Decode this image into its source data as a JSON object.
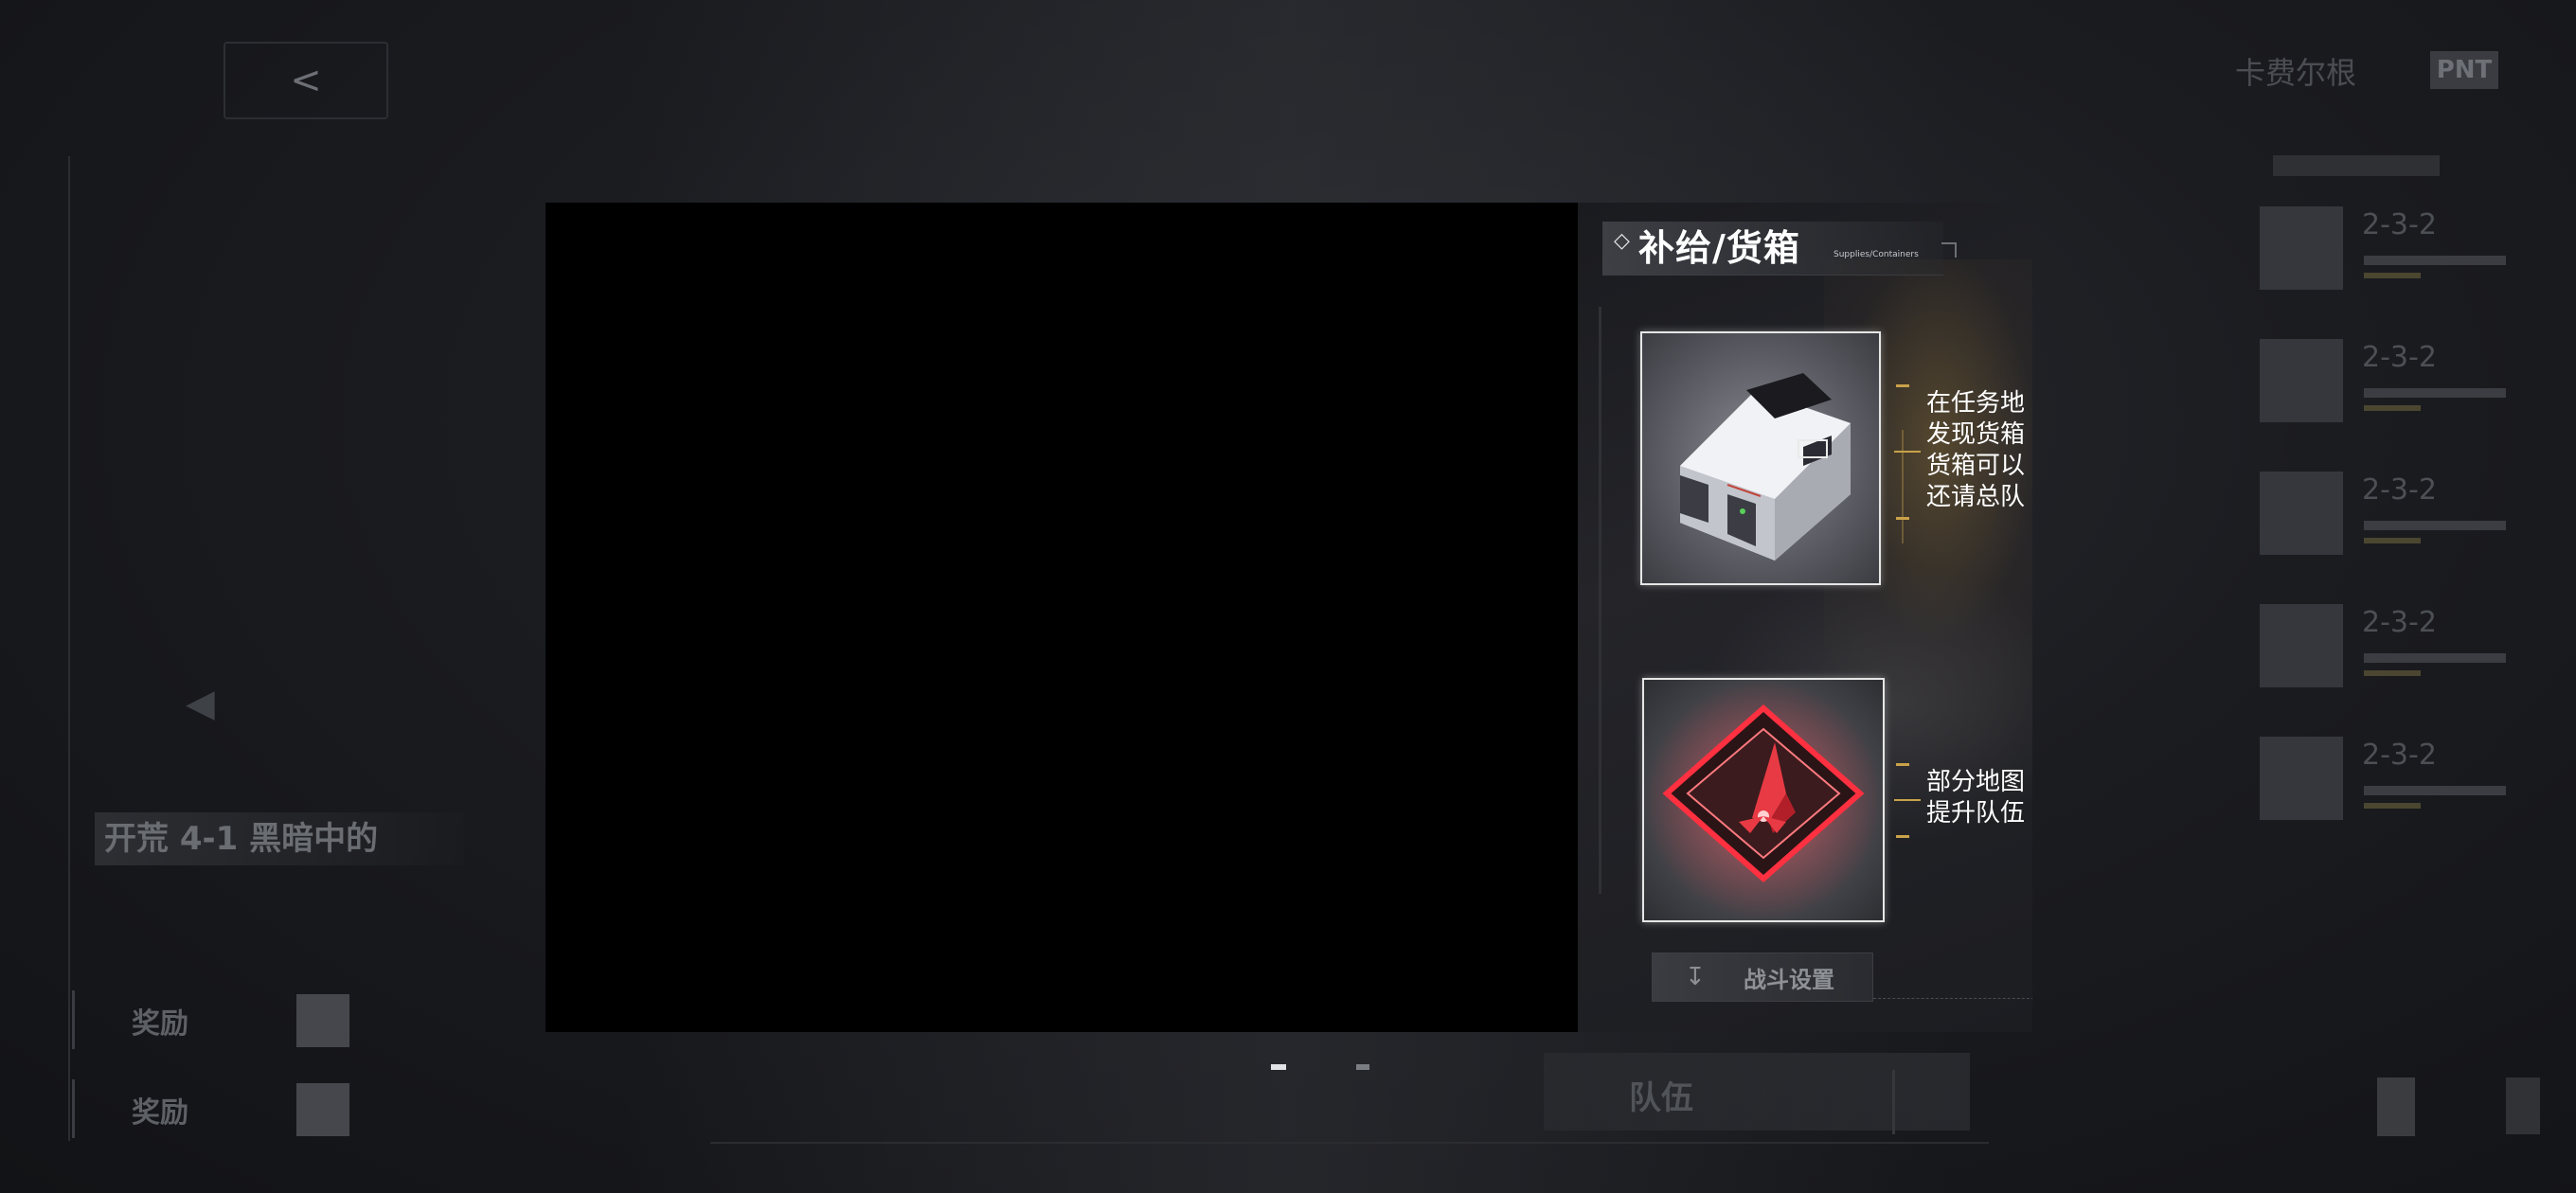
{
  "background": {
    "back_button_icon": "back-arrow-icon",
    "back_button_symbol": "<",
    "top_right_label": "卡费尔根",
    "top_right_tag": "PNT",
    "left_stage_title": "开荒 4-1 黑暗中的",
    "left_slots": [
      {
        "text": "奖励"
      },
      {
        "text": "奖励"
      }
    ],
    "squad_button_label": "队伍",
    "roster": [
      {
        "name": "2-3-2"
      },
      {
        "name": "2-3-2"
      },
      {
        "name": "2-3-2"
      },
      {
        "name": "2-3-2"
      },
      {
        "name": "2-3-2"
      }
    ]
  },
  "modal": {
    "panel": {
      "title": "补给/货箱",
      "subtitle": "Supplies/Containers",
      "title_icon": "diamond-icon",
      "items": [
        {
          "icon": "supply-crate-icon",
          "description_lines": [
            "在任务地",
            "发现货箱",
            "货箱可以",
            "还请总队"
          ]
        },
        {
          "icon": "red-buff-tile-icon",
          "description_lines": [
            "部分地图",
            "提升队伍"
          ]
        }
      ],
      "battle_settings_label": "战斗设置",
      "battle_settings_icon": "battle-settings-icon"
    },
    "pagination": {
      "count": 2,
      "active_index": 0
    }
  },
  "colors": {
    "accent_gold": "#c9a24a",
    "buff_red": "#e0303a",
    "modal_bg": "#000000"
  }
}
